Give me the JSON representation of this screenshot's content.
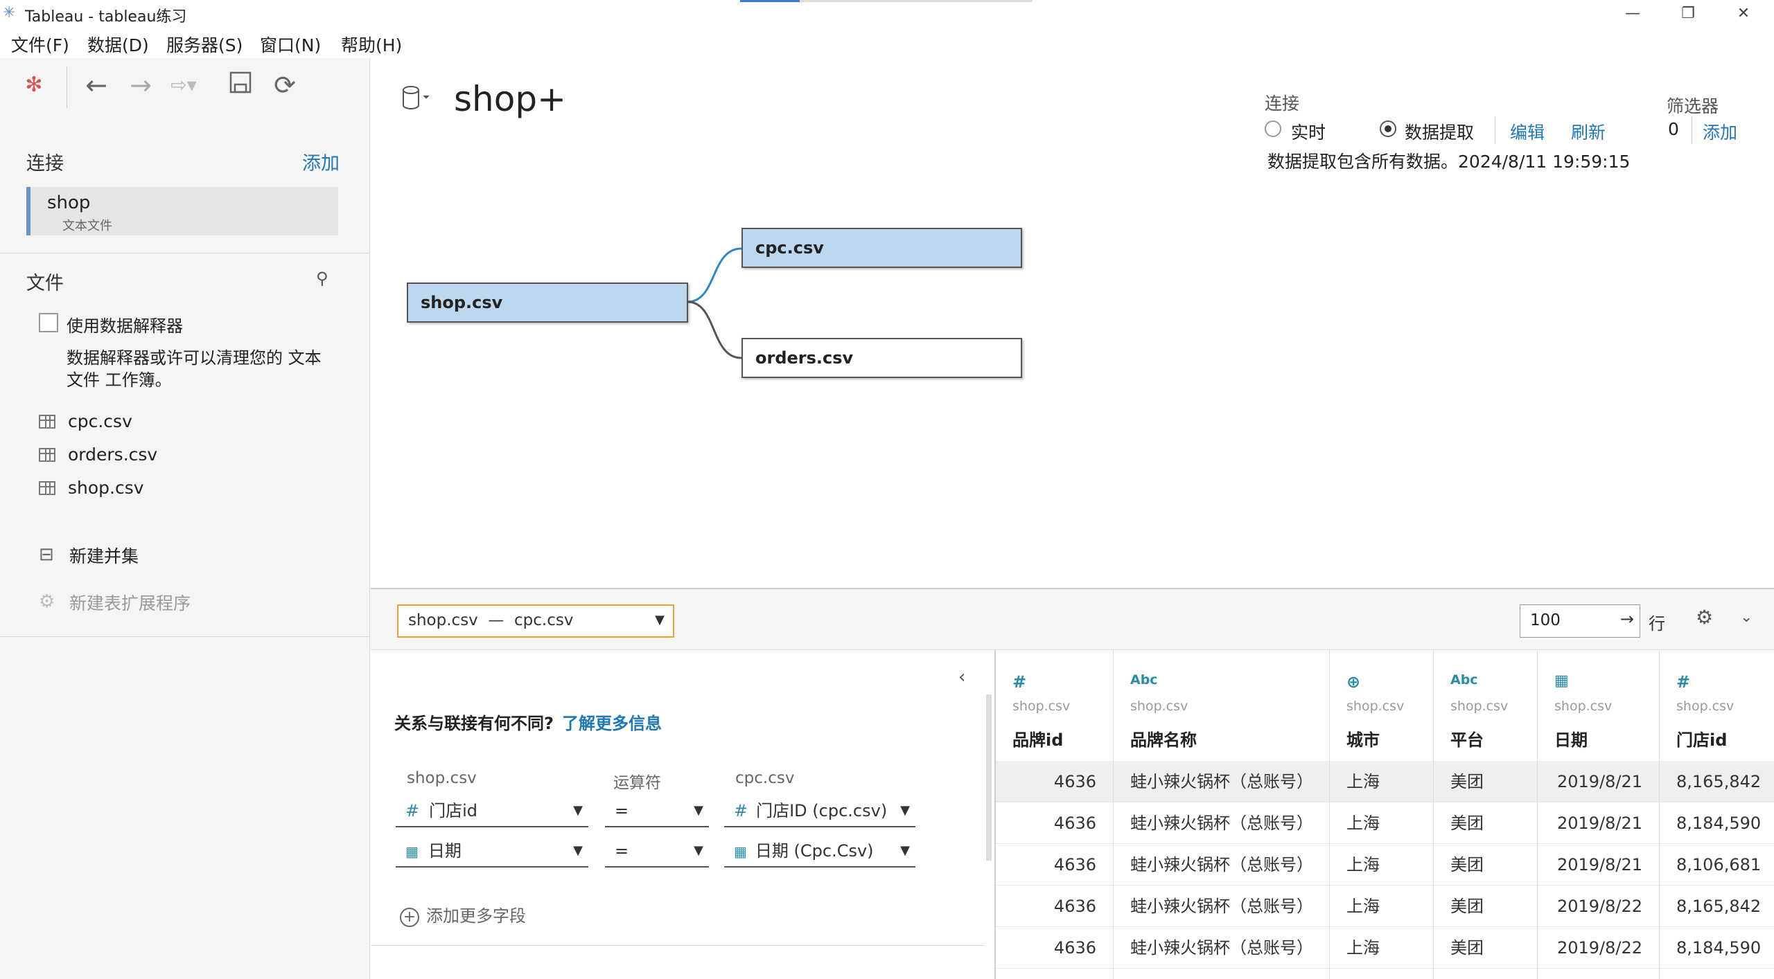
{
  "window": {
    "title": "Tableau - tableau练习"
  },
  "menu": [
    "文件(F)",
    "数据(D)",
    "服务器(S)",
    "窗口(N)",
    "帮助(H)"
  ],
  "left": {
    "connections_title": "连接",
    "add_label": "添加",
    "connection": {
      "name": "shop",
      "type": "文本文件"
    },
    "files_title": "文件",
    "interpreter_label": "使用数据解释器",
    "interpreter_desc_line1": "数据解释器或许可以清理您的 文本",
    "interpreter_desc_line2": "文件 工作簿。",
    "files": [
      "cpc.csv",
      "orders.csv",
      "shop.csv"
    ],
    "new_union": "新建并集",
    "new_extension": "新建表扩展程序"
  },
  "datasource": {
    "name": "shop+"
  },
  "connection_opts": {
    "title": "连接",
    "live": "实时",
    "extract": "数据提取",
    "edit": "编辑",
    "refresh": "刷新",
    "extract_info": "数据提取包含所有数据。2024/8/11 19:59:15",
    "filters_title": "筛选器",
    "filters_count": "0",
    "filters_add": "添加"
  },
  "canvas": {
    "root": "shop.csv",
    "children": [
      "cpc.csv",
      "orders.csv"
    ]
  },
  "bottombar": {
    "relation_select": "shop.csv  —  cpc.csv",
    "rows_value": "100",
    "rows_label": "行"
  },
  "join": {
    "info_text": "关系与联接有何不同?",
    "info_link": "了解更多信息",
    "left_table": "shop.csv",
    "operator_header": "运算符",
    "right_table": "cpc.csv",
    "clauses": [
      {
        "left": "门店id",
        "op": "=",
        "right": "门店ID (cpc.csv)"
      },
      {
        "left": "日期",
        "op": "=",
        "right": "日期 (Cpc.Csv)"
      }
    ],
    "add_more": "添加更多字段"
  },
  "grid": {
    "columns": [
      {
        "type": "#",
        "src": "shop.csv",
        "name": "品牌id"
      },
      {
        "type": "Abc",
        "src": "shop.csv",
        "name": "品牌名称"
      },
      {
        "type": "globe",
        "src": "shop.csv",
        "name": "城市"
      },
      {
        "type": "Abc",
        "src": "shop.csv",
        "name": "平台"
      },
      {
        "type": "date",
        "src": "shop.csv",
        "name": "日期"
      },
      {
        "type": "#",
        "src": "shop.csv",
        "name": "门店id"
      }
    ],
    "rows": [
      [
        "4636",
        "蛙小辣火锅杯（总账号）",
        "上海",
        "美团",
        "2019/8/21",
        "8,165,842"
      ],
      [
        "4636",
        "蛙小辣火锅杯（总账号）",
        "上海",
        "美团",
        "2019/8/21",
        "8,184,590"
      ],
      [
        "4636",
        "蛙小辣火锅杯（总账号）",
        "上海",
        "美团",
        "2019/8/21",
        "8,106,681"
      ],
      [
        "4636",
        "蛙小辣火锅杯（总账号）",
        "上海",
        "美团",
        "2019/8/22",
        "8,165,842"
      ],
      [
        "4636",
        "蛙小辣火锅杯（总账号）",
        "上海",
        "美团",
        "2019/8/22",
        "8,184,590"
      ]
    ]
  },
  "colors": {
    "accent": "#1f77b4",
    "selected_table": "#bdd7ee",
    "select_border": "#f0a030"
  }
}
